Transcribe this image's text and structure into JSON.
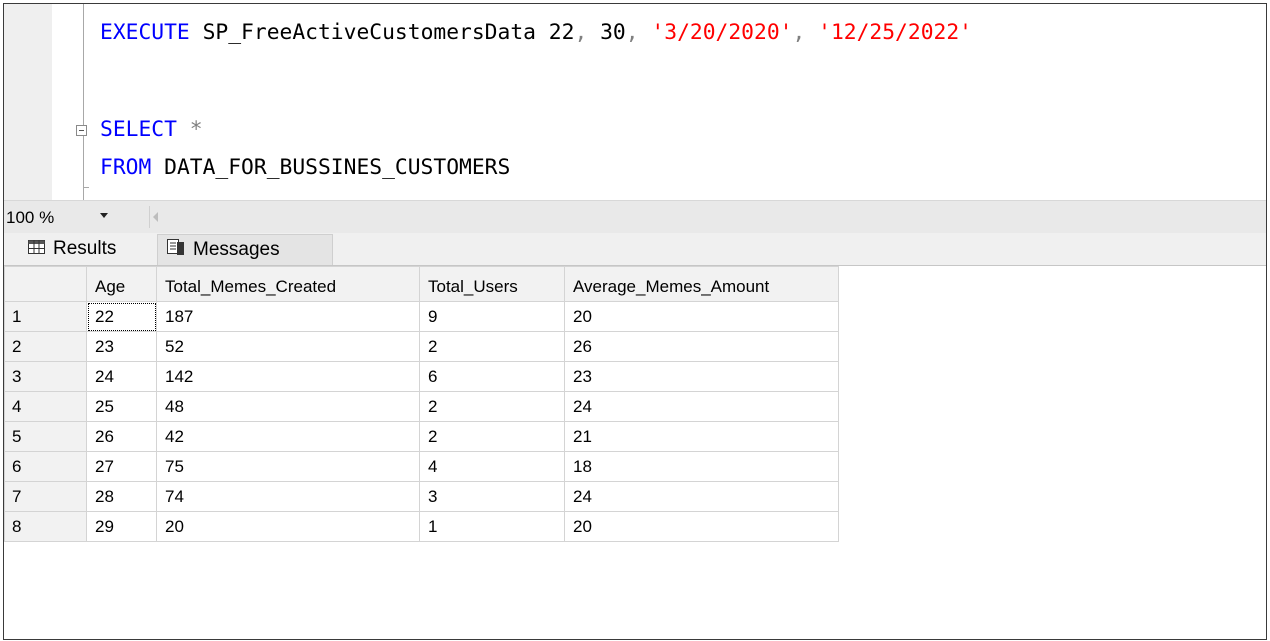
{
  "editor": {
    "line1": {
      "keyword": "EXECUTE",
      "proc": "SP_FreeActiveCustomersData",
      "arg1": "22",
      "arg2": "30",
      "arg3": "'3/20/2020'",
      "arg4": "'12/25/2022'"
    },
    "line2": {
      "keyword": "SELECT",
      "star": "*"
    },
    "line3": {
      "keyword": "FROM",
      "table": "DATA_FOR_BUSSINES_CUSTOMERS"
    }
  },
  "zoom": {
    "value": "100 %"
  },
  "tabs": {
    "results": "Results",
    "messages": "Messages"
  },
  "grid": {
    "columns": [
      "Age",
      "Total_Memes_Created",
      "Total_Users",
      "Average_Memes_Amount"
    ],
    "rows": [
      {
        "n": "1",
        "age": "22",
        "memes": "187",
        "users": "9",
        "avg": "20"
      },
      {
        "n": "2",
        "age": "23",
        "memes": "52",
        "users": "2",
        "avg": "26"
      },
      {
        "n": "3",
        "age": "24",
        "memes": "142",
        "users": "6",
        "avg": "23"
      },
      {
        "n": "4",
        "age": "25",
        "memes": "48",
        "users": "2",
        "avg": "24"
      },
      {
        "n": "5",
        "age": "26",
        "memes": "42",
        "users": "2",
        "avg": "21"
      },
      {
        "n": "6",
        "age": "27",
        "memes": "75",
        "users": "4",
        "avg": "18"
      },
      {
        "n": "7",
        "age": "28",
        "memes": "74",
        "users": "3",
        "avg": "24"
      },
      {
        "n": "8",
        "age": "29",
        "memes": "20",
        "users": "1",
        "avg": "20"
      }
    ]
  },
  "colors": {
    "keyword": "#0000ff",
    "string": "#ff0000",
    "operator": "#808080"
  }
}
